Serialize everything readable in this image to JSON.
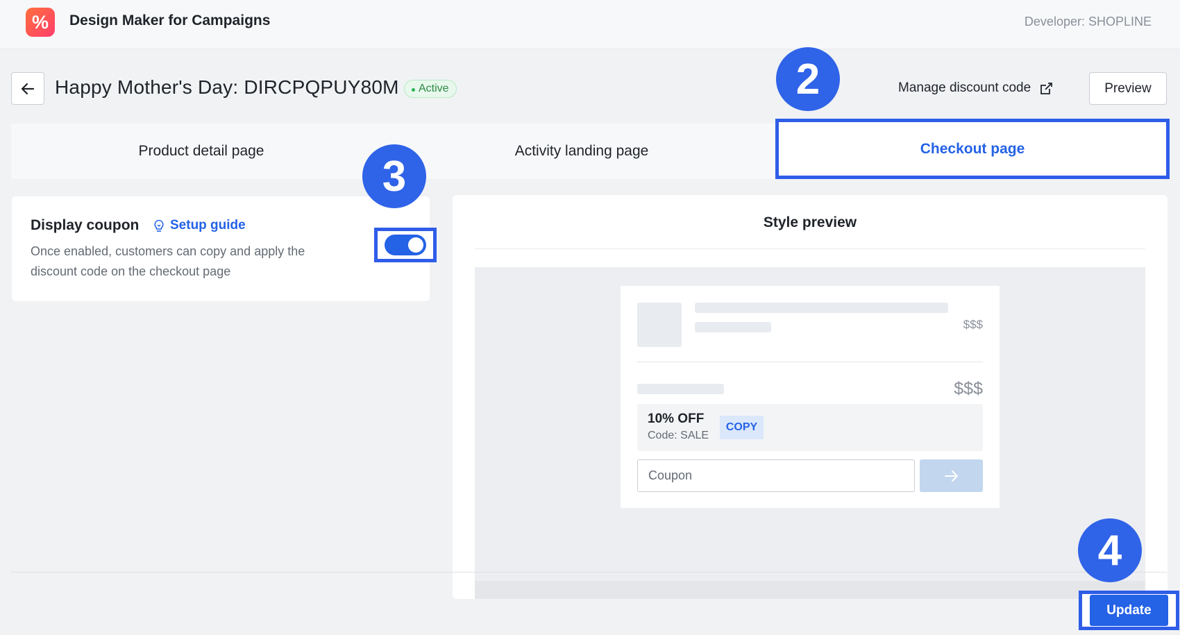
{
  "app": {
    "logo_glyph": "%",
    "title": "Design Maker for Campaigns",
    "developer": "Developer: SHOPLINE"
  },
  "header": {
    "title": "Happy Mother's Day: DIRCPQPUY80M",
    "status": "Active",
    "manage_link": "Manage discount code",
    "preview_label": "Preview"
  },
  "tabs": [
    {
      "label": "Product detail page",
      "active": false
    },
    {
      "label": "Activity landing page",
      "active": false
    },
    {
      "label": "Checkout page",
      "active": true
    }
  ],
  "markers": [
    "2",
    "3",
    "4"
  ],
  "setting": {
    "title": "Display coupon",
    "guide_label": "Setup guide",
    "description": "Once enabled, customers can copy and apply the discount code on the checkout page",
    "enabled": true
  },
  "style_preview": {
    "title": "Style preview",
    "price_small": "$$$",
    "price_large": "$$$",
    "coupon_offer": "10% OFF",
    "coupon_code": "Code: SALE",
    "copy_label": "COPY",
    "input_placeholder": "Coupon"
  },
  "footer": {
    "update_label": "Update"
  },
  "colors": {
    "accent": "#2462e6",
    "highlight_frame": "#2f5de8",
    "status_green": "#2fb454"
  },
  "icons": {
    "back": "arrow-left-icon",
    "external": "external-link-icon",
    "guide": "lightbulb-icon",
    "apply": "arrow-right-icon"
  }
}
